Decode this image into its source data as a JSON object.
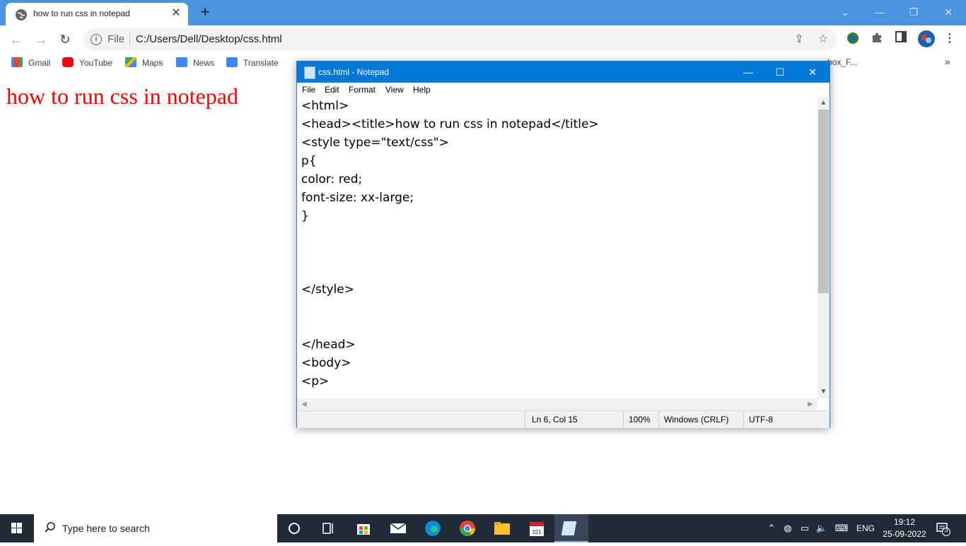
{
  "browser": {
    "tab_title": "how to run css in notepad",
    "tab_close": "✕",
    "new_tab": "+",
    "window_controls": [
      "⌄",
      "—",
      "❐",
      "✕"
    ],
    "address": {
      "scheme": "File",
      "url": "C:/Users/Dell/Desktop/css.html"
    },
    "bookmarks": [
      {
        "label": "Gmail",
        "icon": "gmail-icon",
        "color": "#ea4335"
      },
      {
        "label": "YouTube",
        "icon": "youtube-icon",
        "color": "#ff0000"
      },
      {
        "label": "Maps",
        "icon": "maps-icon",
        "color": "#34a853"
      },
      {
        "label": "News",
        "icon": "news-icon",
        "color": "#4285f4"
      },
      {
        "label": "Translate",
        "icon": "translate-icon",
        "color": "#4285f4"
      }
    ],
    "bookmarks_more": "»",
    "bookmark_partial": "box_F..."
  },
  "page": {
    "heading": "how to run css in notepad",
    "heading_color": "#ff0000"
  },
  "notepad": {
    "title": "css.html - Notepad",
    "controls": [
      "—",
      "☐",
      "✕"
    ],
    "menu": [
      "File",
      "Edit",
      "Format",
      "View",
      "Help"
    ],
    "lines": [
      "<html>",
      "<head><title>how to run css in notepad</title>",
      "<style type=\"text/css\">",
      "p{",
      "color: red;",
      "font-size: xx-large;",
      "}",
      "",
      "",
      "",
      "</style>",
      "",
      "",
      "</head>",
      "<body>",
      "<p>"
    ],
    "status": {
      "position": "Ln 6, Col 15",
      "zoom": "100%",
      "line_endings": "Windows (CRLF)",
      "encoding": "UTF-8"
    }
  },
  "taskbar": {
    "search_placeholder": "Type here to search",
    "language": "ENG",
    "time": "19:12",
    "date": "25-09-2022",
    "notification_count": "3",
    "accent": "#0078d7"
  }
}
